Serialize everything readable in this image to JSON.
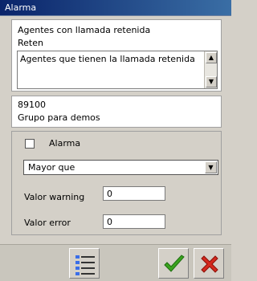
{
  "window": {
    "title": "Alarma"
  },
  "info": {
    "title": "Agentes con llamada retenida",
    "code": "Reten",
    "description": "Agentes que tienen la llamada retenida"
  },
  "group": {
    "id": "89100",
    "name": "Grupo para demos"
  },
  "alarm": {
    "checkbox_label": "Alarma",
    "checked": false,
    "comparison": "Mayor que",
    "warning_label": "Valor warning",
    "warning_value": "0",
    "error_label": "Valor error",
    "error_value": "0"
  },
  "colors": {
    "title_bar": "#0a246a",
    "ok_green": "#3aa31e",
    "cancel_red": "#d42a1e"
  },
  "icons": {
    "list": "list-icon",
    "ok": "checkmark-icon",
    "cancel": "close-icon"
  }
}
